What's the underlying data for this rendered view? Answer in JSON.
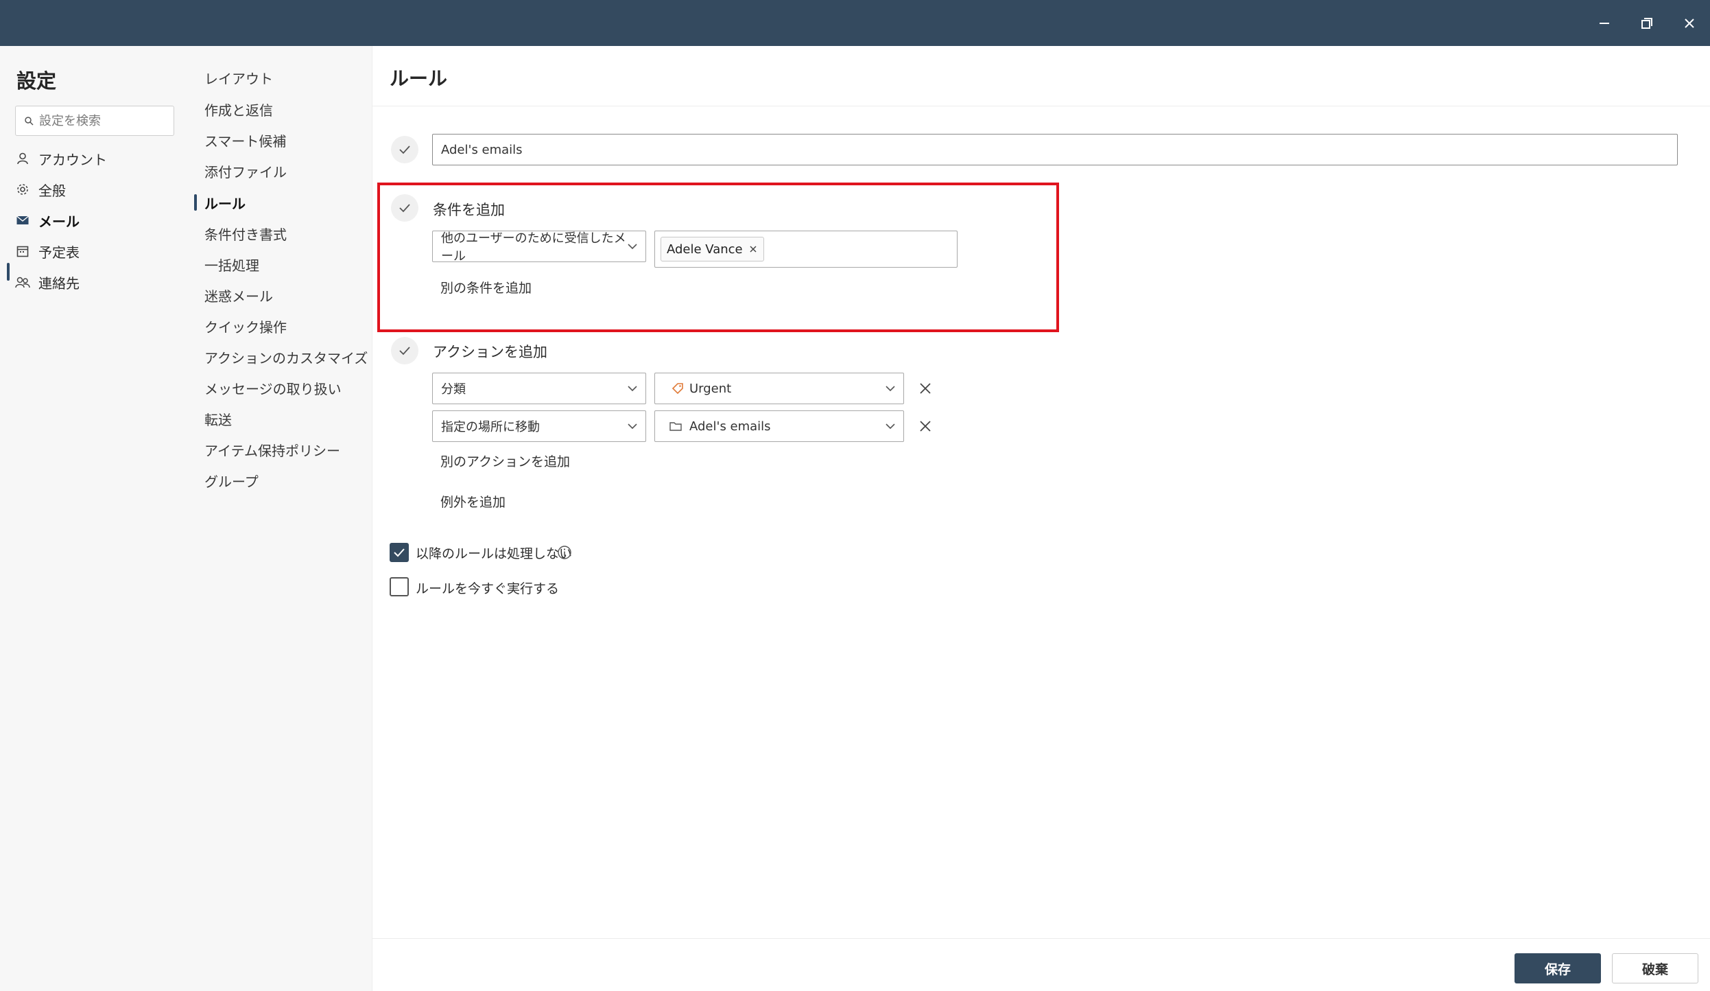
{
  "window": {
    "controls": {
      "minimize": "minimize-icon",
      "restore": "restore-icon",
      "close": "close-icon"
    },
    "titlebar_color": "#344a5f"
  },
  "sidebar": {
    "title": "設定",
    "search_placeholder": "設定を検索",
    "categories": [
      {
        "label": "アカウント",
        "icon": "person-icon"
      },
      {
        "label": "全般",
        "icon": "gear-icon"
      },
      {
        "label": "メール",
        "icon": "mail-icon",
        "active": true
      },
      {
        "label": "予定表",
        "icon": "calendar-icon"
      },
      {
        "label": "連絡先",
        "icon": "people-icon"
      }
    ]
  },
  "subnav": {
    "items": [
      {
        "label": "レイアウト"
      },
      {
        "label": "作成と返信"
      },
      {
        "label": "スマート候補"
      },
      {
        "label": "添付ファイル"
      },
      {
        "label": "ルール",
        "active": true
      },
      {
        "label": "条件付き書式"
      },
      {
        "label": "一括処理"
      },
      {
        "label": "迷惑メール"
      },
      {
        "label": "クイック操作"
      },
      {
        "label": "アクションのカスタマイズ"
      },
      {
        "label": "メッセージの取り扱い"
      },
      {
        "label": "転送"
      },
      {
        "label": "アイテム保持ポリシー"
      },
      {
        "label": "グループ"
      }
    ]
  },
  "main": {
    "title": "ルール",
    "rule_name": "Adel's emails",
    "conditions": {
      "label": "条件を追加",
      "condition_select": "他のユーザーのために受信したメール",
      "recipient_tag": "Adele Vance",
      "add_another": "別の条件を追加"
    },
    "actions": {
      "label": "アクションを追加",
      "rows": [
        {
          "action": "分類",
          "value": "Urgent",
          "value_icon": "tag-icon"
        },
        {
          "action": "指定の場所に移動",
          "value": "Adel's emails",
          "value_icon": "folder-icon"
        }
      ],
      "add_another": "別のアクションを追加"
    },
    "add_exception": "例外を追加",
    "options": {
      "stop_processing": {
        "label": "以降のルールは処理しない",
        "checked": true
      },
      "run_now": {
        "label": "ルールを今すぐ実行する",
        "checked": false
      }
    },
    "footer": {
      "save": "保存",
      "discard": "破棄"
    }
  },
  "colors": {
    "accent": "#344a5f",
    "highlight_border": "#e0141e"
  }
}
